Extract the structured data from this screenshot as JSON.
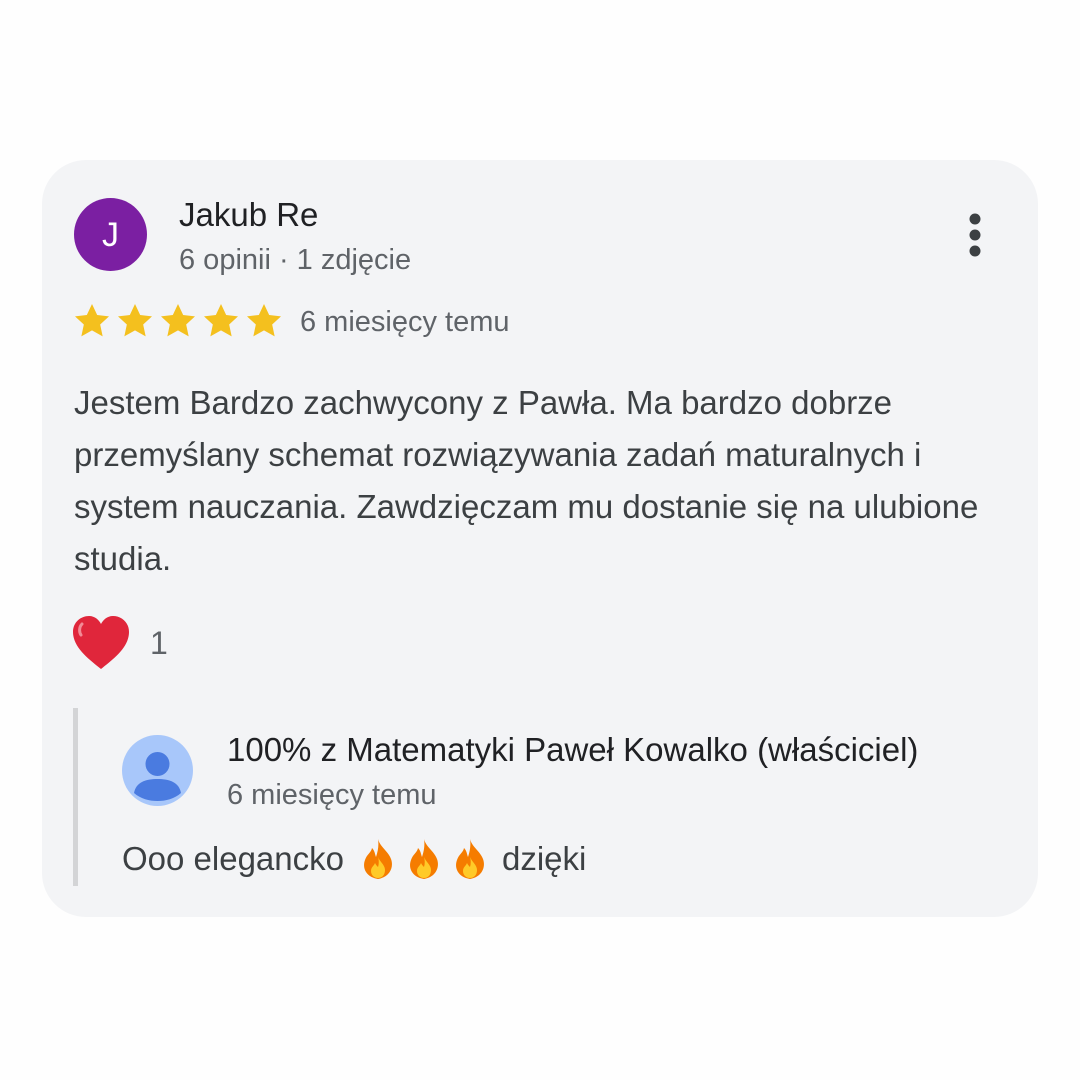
{
  "review": {
    "author_initial": "J",
    "author_name": "Jakub Re",
    "author_meta": "6 opinii · 1 zdjęcie",
    "rating": 5,
    "rating_max": 5,
    "date": "6 miesięcy temu",
    "text": "Jestem Bardzo zachwycony z Pawła. Ma bardzo dobrze przemyślany schemat rozwiązywania zadań maturalnych i system nauczania. Zawdzięczam mu dostanie się na ulubione studia.",
    "reaction_icon": "red-heart-icon",
    "reaction_count": "1",
    "more_icon": "more-vertical-icon"
  },
  "reply": {
    "owner_name": "100% z Matematyki Paweł Kowalko (właściciel)",
    "date": "6 miesięcy temu",
    "text_before": "Ooo elegancko",
    "emoji": [
      "fire-icon",
      "fire-icon",
      "fire-icon"
    ],
    "text_after": "dzięki"
  },
  "colors": {
    "card_background": "#f3f4f6",
    "author_avatar": "#7b1fa2",
    "owner_avatar": "#a8c7fa",
    "star": "#f4c01e",
    "heart": "#e0263b"
  }
}
